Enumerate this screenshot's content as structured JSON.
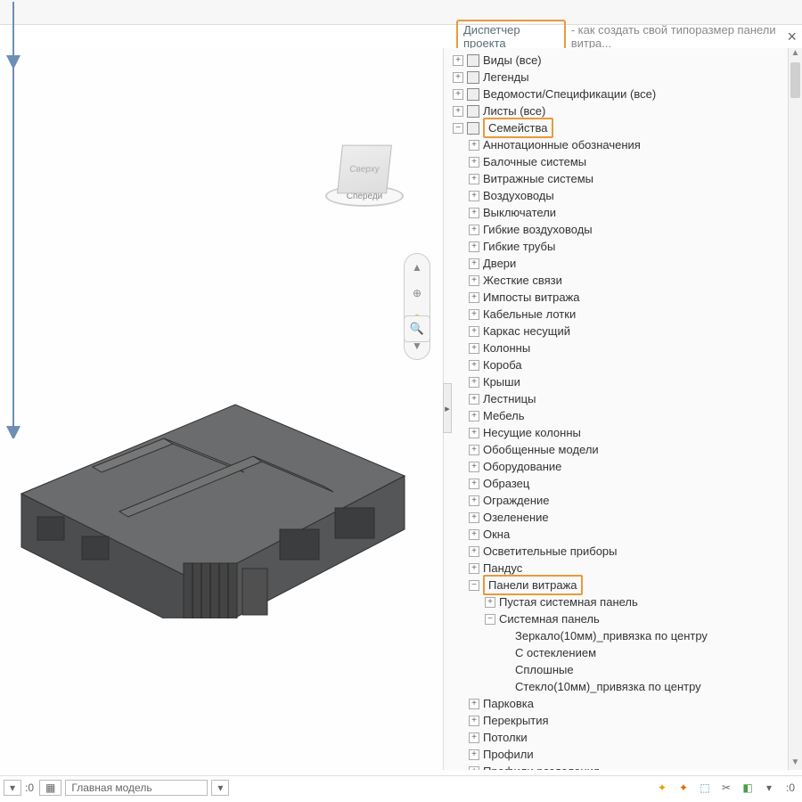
{
  "panel_title": "Диспетчер проекта",
  "panel_subtitle": "- как создать свой типоразмер панели витра...",
  "viewcube_face": "Спереди",
  "viewcube_top": "Сверху",
  "tree_top": [
    {
      "label": "Виды (все)",
      "icon": "v"
    },
    {
      "label": "Легенды",
      "icon": "l"
    },
    {
      "label": "Ведомости/Спецификации (все)",
      "icon": "t"
    },
    {
      "label": "Листы (все)",
      "icon": "s"
    }
  ],
  "families_label": "Семейства",
  "families": [
    "Аннотационные обозначения",
    "Балочные системы",
    "Витражные системы",
    "Воздуховоды",
    "Выключатели",
    "Гибкие воздуховоды",
    "Гибкие трубы",
    "Двери",
    "Жесткие связи",
    "Импосты витража",
    "Кабельные лотки",
    "Каркас несущий",
    "Колонны",
    "Короба",
    "Крыши",
    "Лестницы",
    "Мебель",
    "Несущие колонны",
    "Обобщенные модели",
    "Оборудование",
    "Образец",
    "Ограждение",
    "Озеленение",
    "Окна",
    "Осветительные приборы",
    "Пандус"
  ],
  "curtain_panel_label": "Панели витража",
  "curtain_children": {
    "a": "Пустая системная панель",
    "b_label": "Системная панель",
    "b_children": [
      "Зеркало(10мм)_привязка по центру",
      "С остеклением",
      "Сплошные",
      "Стекло(10мм)_привязка по центру"
    ]
  },
  "families_after": [
    "Парковка",
    "Перекрытия",
    "Потолки",
    "Профили",
    "Профили разделения"
  ],
  "status": {
    "zero1": ":0",
    "zero2": ":0",
    "model_label": "Главная модель",
    "funnel": ":0"
  }
}
